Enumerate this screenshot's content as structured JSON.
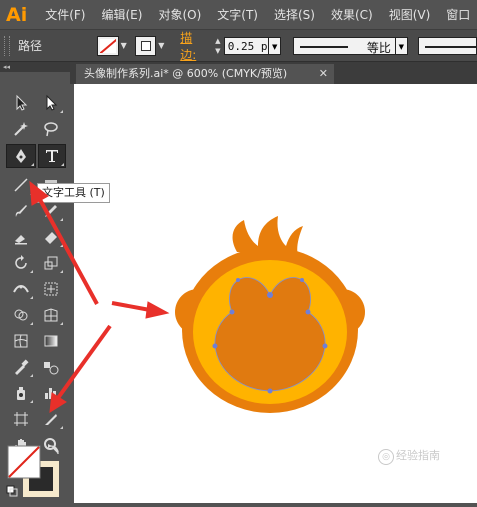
{
  "app": {
    "logo": "Ai"
  },
  "menubar": {
    "items": [
      "文件(F)",
      "编辑(E)",
      "对象(O)",
      "文字(T)",
      "选择(S)",
      "效果(C)",
      "视图(V)",
      "窗口"
    ]
  },
  "controlbar": {
    "selection_label": "路径",
    "stroke_label": "描边:",
    "stroke_weight": "0.25 p",
    "profile_label": "等比"
  },
  "document": {
    "tab_title": "头像制作系列.ai* @ 600% (CMYK/预览)",
    "close_glyph": "✕"
  },
  "tooltip": {
    "text": "文字工具 (T)"
  },
  "watermark": {
    "text": "经验指南"
  },
  "colors": {
    "monkey_outer": "#e87e0c",
    "monkey_inner": "#ffb300",
    "monkey_face": "#e07a10",
    "arrow_red": "#e8302a",
    "accent_orange": "#ff9a00"
  }
}
